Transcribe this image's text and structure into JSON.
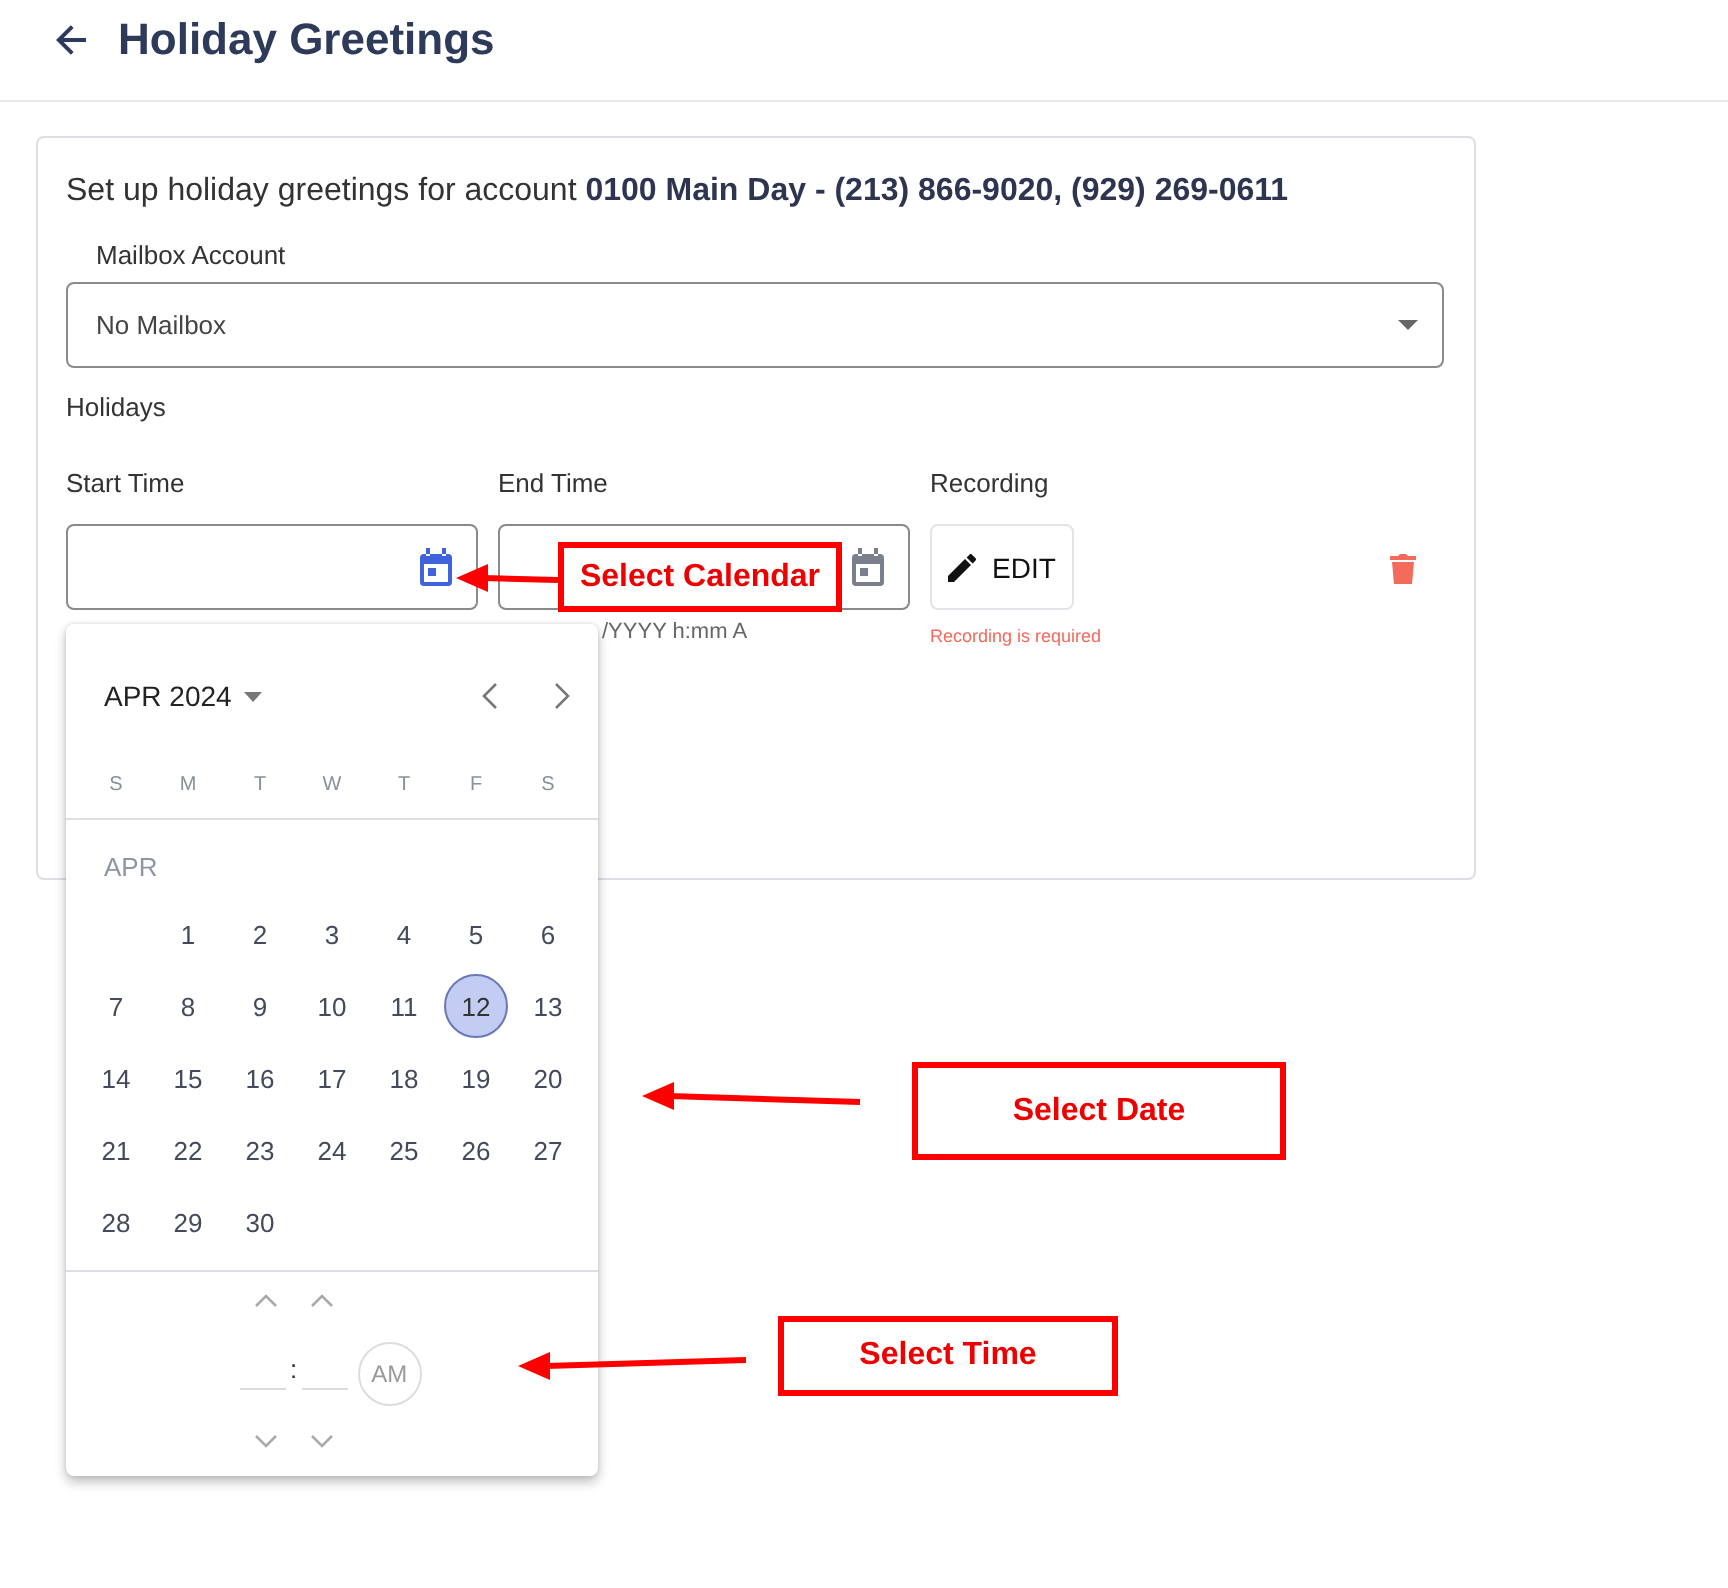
{
  "header": {
    "title": "Holiday Greetings"
  },
  "intro": "Set up holiday greetings for account **0100 Main Day - (213) 866-9020, (929) 269-0611**",
  "mailbox": {
    "label": "Mailbox Account",
    "value": "No Mailbox"
  },
  "holidays_label": "Holidays",
  "columns": [
    {
      "label": "Start Time"
    },
    {
      "label": "End Time"
    },
    {
      "label": "Recording"
    }
  ],
  "start_field": {
    "active": true
  },
  "end_field": {
    "active": false,
    "hint": "/YYYY h:mm A"
  },
  "recording": {
    "button": "EDIT",
    "error": "Recording is required"
  },
  "calendar": {
    "month_label": "APR 2024",
    "weekdays": [
      "S",
      "M",
      "T",
      "W",
      "T",
      "F",
      "S"
    ],
    "month_short": "APR",
    "weeks": [
      [
        {
          "label": "1",
          "selected": false
        },
        {
          "label": "2",
          "selected": false
        },
        {
          "label": "3",
          "selected": false
        },
        {
          "label": "4",
          "selected": false
        },
        {
          "label": "5",
          "selected": false
        },
        {
          "label": "6",
          "selected": false
        }
      ],
      [
        {
          "label": "7",
          "selected": false
        },
        {
          "label": "8",
          "selected": false
        },
        {
          "label": "9",
          "selected": false
        },
        {
          "label": "10",
          "selected": false
        },
        {
          "label": "11",
          "selected": false
        },
        {
          "label": "12",
          "selected": true
        },
        {
          "label": "13",
          "selected": false
        }
      ],
      [
        {
          "label": "14",
          "selected": false
        },
        {
          "label": "15",
          "selected": false
        },
        {
          "label": "16",
          "selected": false
        },
        {
          "label": "17",
          "selected": false
        },
        {
          "label": "18",
          "selected": false
        },
        {
          "label": "19",
          "selected": false
        },
        {
          "label": "20",
          "selected": false
        }
      ],
      [
        {
          "label": "21",
          "selected": false
        },
        {
          "label": "22",
          "selected": false
        },
        {
          "label": "23",
          "selected": false
        },
        {
          "label": "24",
          "selected": false
        },
        {
          "label": "25",
          "selected": false
        },
        {
          "label": "26",
          "selected": false
        },
        {
          "label": "27",
          "selected": false
        }
      ],
      [
        {
          "label": "28",
          "selected": false
        },
        {
          "label": "29",
          "selected": false
        },
        {
          "label": "30",
          "selected": false
        }
      ]
    ],
    "time": {
      "separator": ":",
      "period": "AM"
    }
  },
  "annotations": [
    {
      "text": "Select Calendar"
    },
    {
      "text": "Select Date"
    },
    {
      "text": "Select Time"
    }
  ]
}
